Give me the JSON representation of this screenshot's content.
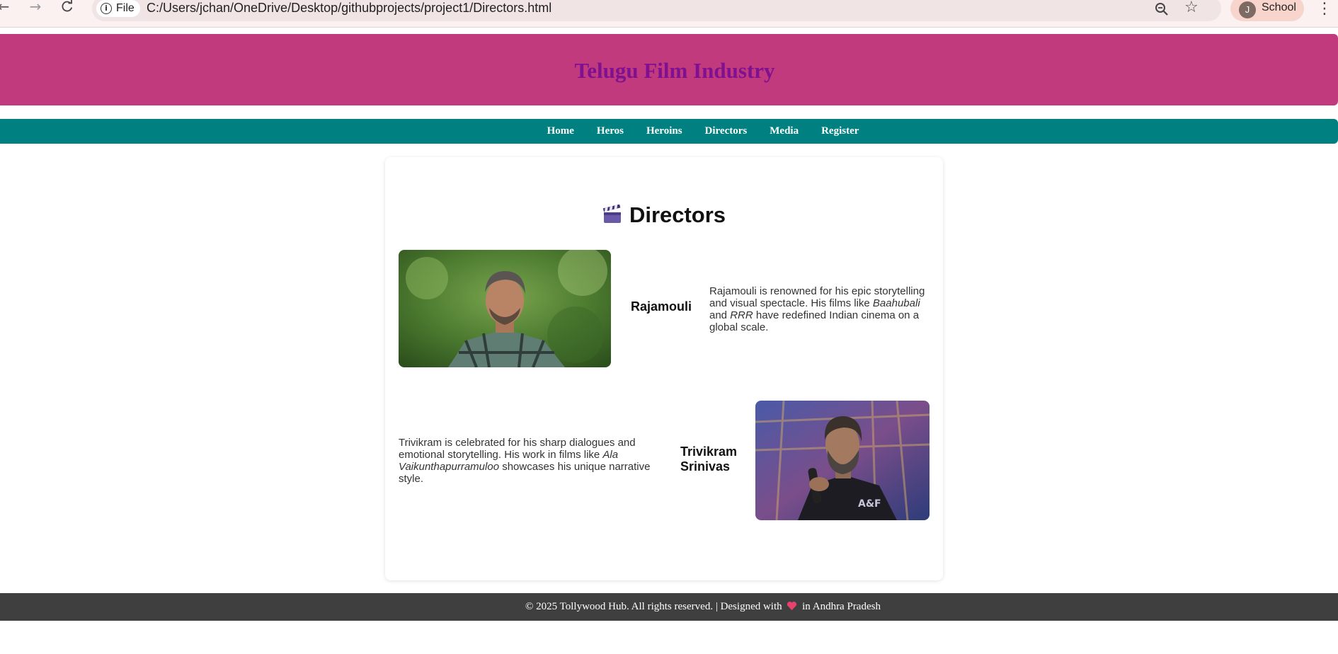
{
  "browser": {
    "file_chip_label": "File",
    "url": "C:/Users/jchan/OneDrive/Desktop/githubprojects/project1/Directors.html",
    "profile_initial": "J",
    "profile_label": "School"
  },
  "site": {
    "title": "Telugu Film Industry"
  },
  "nav": {
    "items": [
      {
        "label": "Home"
      },
      {
        "label": "Heros"
      },
      {
        "label": "Heroins"
      },
      {
        "label": "Directors"
      },
      {
        "label": "Media"
      },
      {
        "label": "Register"
      }
    ]
  },
  "main": {
    "heading": "Directors",
    "heading_icon": "clapper-board-icon",
    "directors": [
      {
        "name": "Rajamouli",
        "desc_before": "Rajamouli is renowned for his epic storytelling and visual spectacle. His films like ",
        "film1": "Baahubali",
        "desc_mid": " and ",
        "film2": "RRR",
        "desc_after": " have redefined Indian cinema on a global scale."
      },
      {
        "name": "Trivikram Srinivas",
        "desc_before": "Trivikram is celebrated for his sharp dialogues and emotional storytelling. His work in films like ",
        "film1": "Ala Vaikunthapurramuloo",
        "desc_after": " showcases his unique narrative style."
      }
    ]
  },
  "footer": {
    "before_heart": "© 2025 Tollywood Hub. All rights reserved. | Designed with",
    "heart_icon": "heart-icon",
    "after_heart": "in Andhra Pradesh"
  },
  "colors": {
    "header_bg": "#c23a7e",
    "title_color": "#7f1190",
    "nav_bg": "#008080",
    "footer_bg": "#3f3f3f"
  }
}
